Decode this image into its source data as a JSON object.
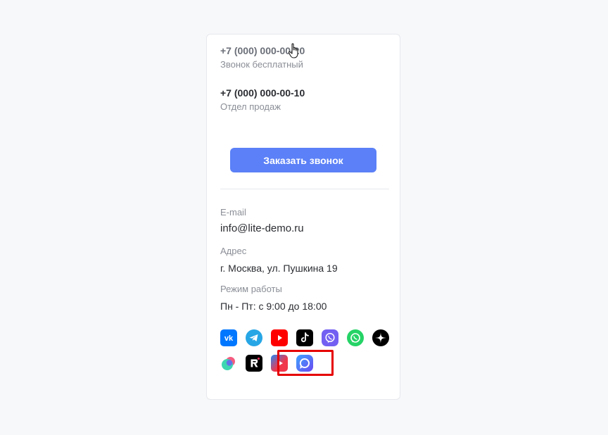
{
  "contacts": {
    "phone_free": "+7 (000) 000-00-20",
    "phone_free_note": "Звонок бесплатный",
    "phone_sales": "+7 (000) 000-00-10",
    "phone_sales_note": "Отдел продаж",
    "call_button_label": "Заказать звонок"
  },
  "info": {
    "email_label": "E-mail",
    "email_value": "info@lite-demo.ru",
    "address_label": "Адрес",
    "address_value": "г. Москва, ул. Пушкина 19",
    "hours_label": "Режим работы",
    "hours_value": "Пн - Пт: с 9:00 до 18:00"
  },
  "socials": [
    {
      "name": "vk-icon",
      "color": "#0077ff"
    },
    {
      "name": "telegram-icon",
      "color": "#27a6e5"
    },
    {
      "name": "youtube-icon",
      "color": "#ff0000"
    },
    {
      "name": "tiktok-icon",
      "color": "#000000"
    },
    {
      "name": "viber-icon",
      "color": "#7360f2"
    },
    {
      "name": "whatsapp-icon",
      "color": "#25d366"
    },
    {
      "name": "zen-icon",
      "color": "#000000"
    },
    {
      "name": "odnoklassniki-circles-icon",
      "color": "#3dd6b0"
    },
    {
      "name": "rutube-icon",
      "color": "#000000"
    },
    {
      "name": "vk-video-icon",
      "color": "#f0374b"
    },
    {
      "name": "max-messenger-icon",
      "color": "#5b6cf5"
    }
  ],
  "colors": {
    "accent": "#5b80f7",
    "highlight": "#e60000"
  }
}
